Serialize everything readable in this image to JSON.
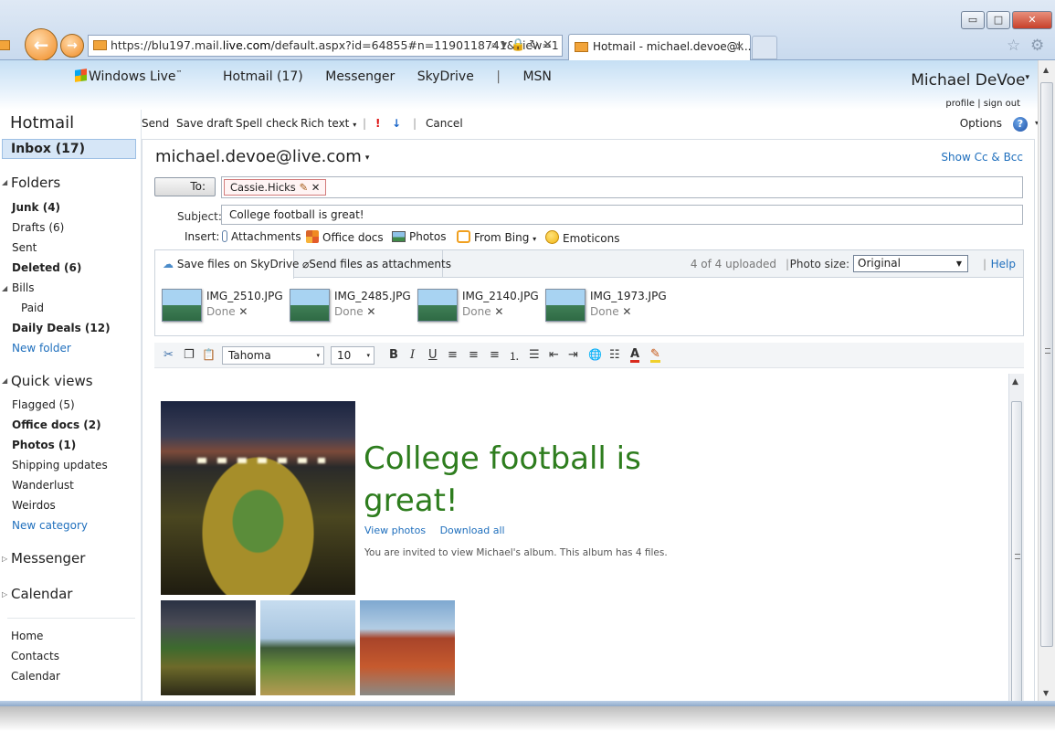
{
  "browser": {
    "url_prefix": "https://blu197.mail.",
    "url_domain": "live.com",
    "url_rest": "/default.aspx?id=64855#n=1190118741&view=1",
    "tab_title": "Hotmail - michael.devoe@l...",
    "window_controls": [
      "▭",
      "□",
      "✕"
    ]
  },
  "header": {
    "brand": "Windows Live",
    "brand_tm": "™",
    "nav": [
      "Hotmail (17)",
      "Messenger",
      "SkyDrive",
      "MSN"
    ],
    "nav_sep": "|",
    "user_name": "Michael DeVoe",
    "user_caret": "▾",
    "profile_link": "profile",
    "links_sep": "|",
    "signout_link": "sign out"
  },
  "sidebar": {
    "title": "Hotmail",
    "inbox": "Inbox (17)",
    "folders_title": "Folders",
    "folders": [
      {
        "label": "Junk (4)",
        "bold": true
      },
      {
        "label": "Drafts (6)",
        "bold": false
      },
      {
        "label": "Sent",
        "bold": false
      },
      {
        "label": "Deleted (6)",
        "bold": true
      },
      {
        "label": "Bills",
        "bold": false
      },
      {
        "label": "Paid",
        "bold": false
      },
      {
        "label": "Daily Deals (12)",
        "bold": true
      }
    ],
    "new_folder": "New folder",
    "quick_views_title": "Quick views",
    "quick_views": [
      {
        "label": "Flagged (5)",
        "bold": false
      },
      {
        "label": "Office docs (2)",
        "bold": true
      },
      {
        "label": "Photos (1)",
        "bold": true
      },
      {
        "label": "Shipping updates",
        "bold": false
      },
      {
        "label": "Wanderlust",
        "bold": false
      },
      {
        "label": "Weirdos",
        "bold": false
      }
    ],
    "new_category": "New category",
    "messenger": "Messenger",
    "calendar": "Calendar",
    "bottom_links": [
      "Home",
      "Contacts",
      "Calendar"
    ]
  },
  "toolbar": {
    "send": "Send",
    "save_draft": "Save draft",
    "spell_check": "Spell check",
    "rich_text": "Rich text",
    "rich_caret": "▾",
    "sep": "|",
    "high_priority": "!",
    "low_priority": "↓",
    "cancel": "Cancel",
    "options": "Options",
    "help": "?",
    "help_caret": "▾"
  },
  "compose": {
    "from": "michael.devoe@live.com",
    "from_caret": "▾",
    "show_cc_bcc": "Show Cc & Bcc",
    "to_button": "To:",
    "recipient": "Cassie.Hicks",
    "recipient_edit": "✎",
    "recipient_remove": "✕",
    "subject_label": "Subject:",
    "subject": "College football is great!",
    "insert_label": "Insert:",
    "insert": {
      "attachments": "Attachments",
      "office_docs": "Office docs",
      "photos": "Photos",
      "from_bing": "From Bing",
      "bing_caret": "▾",
      "emoticons": "Emoticons"
    }
  },
  "upload": {
    "tab_skydrive": "Save files on SkyDrive",
    "tab_attach": "Send files as attachments",
    "status": "4 of 4 uploaded",
    "sep": "|",
    "photo_size_label": "Photo size:",
    "photo_size": "Original",
    "select_caret": "▼",
    "help": "Help",
    "files": [
      {
        "name": "IMG_2510.JPG",
        "status": "Done"
      },
      {
        "name": "IMG_2485.JPG",
        "status": "Done"
      },
      {
        "name": "IMG_2140.JPG",
        "status": "Done"
      },
      {
        "name": "IMG_1973.JPG",
        "status": "Done"
      }
    ],
    "remove_glyph": "✕"
  },
  "format": {
    "font": "Tahoma",
    "size": "10",
    "select_caret": "▾",
    "icons": {
      "cut": "✂",
      "copy": "❐",
      "paste": "📋",
      "bold": "B",
      "italic": "I",
      "underline": "U",
      "align_left": "≡",
      "align_center": "≡",
      "align_right": "≡",
      "numbered_list": "⒈",
      "bullet_list": "☰",
      "outdent": "⇤",
      "indent": "⇥",
      "link": "🌐",
      "spacing": "☷",
      "font_color": "A",
      "highlight": "✎"
    }
  },
  "album": {
    "title": "College football is great!",
    "view_photos": "View photos",
    "download_all": "Download all",
    "description": "You are invited to view Michael's album. This album has 4 files."
  },
  "scroll_glyphs": {
    "up": "▲",
    "down": "▼"
  }
}
